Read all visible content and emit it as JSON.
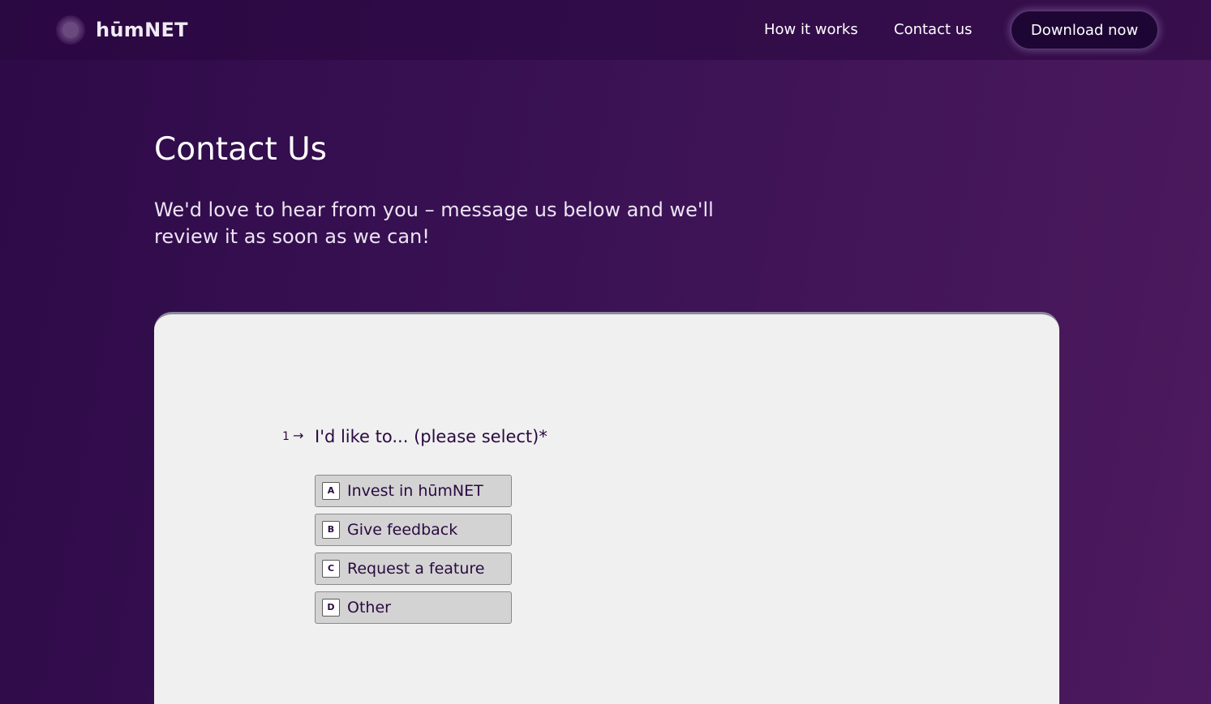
{
  "header": {
    "brand": "hūmNET",
    "nav": {
      "how_it_works": "How it works",
      "contact_us": "Contact us",
      "download": "Download now"
    }
  },
  "main": {
    "title": "Contact Us",
    "subtitle": "We'd love to hear from you – message us below and we'll review it as soon as we can!"
  },
  "form": {
    "question_number": "1",
    "question_arrow": "→",
    "question": "I'd like to... (please select)*",
    "options": [
      {
        "key": "A",
        "label": "Invest in hūmNET"
      },
      {
        "key": "B",
        "label": "Give feedback"
      },
      {
        "key": "C",
        "label": "Request a feature"
      },
      {
        "key": "D",
        "label": "Other"
      }
    ]
  },
  "colors": {
    "background_dark": "#2e0a48",
    "background_light": "#4d1a5e",
    "card": "#f0f0f0",
    "option_fill": "#d3d3d3",
    "text_dark": "#2a0a40"
  }
}
